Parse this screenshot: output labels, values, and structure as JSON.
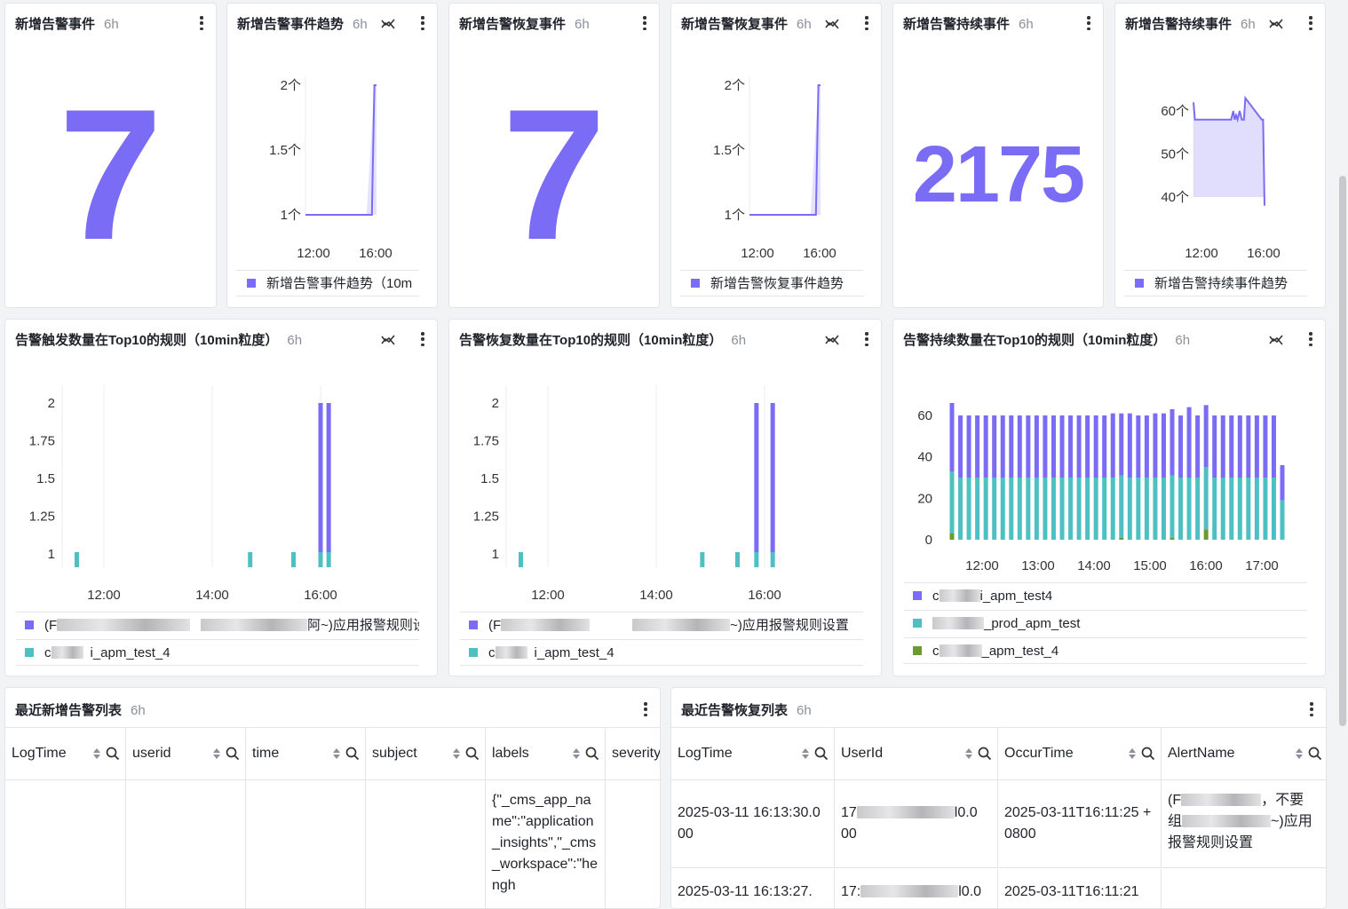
{
  "colors": {
    "purple": "#7b6cf6",
    "teal": "#4fc0c2",
    "green": "#6b9b2e",
    "area": "#d9d5fb",
    "grid": "#ececee",
    "axis": "#333333"
  },
  "icons": {
    "menu": "more-vertical-icon",
    "trend": "trend-toggle-icon",
    "sort": "sort-icon",
    "search": "search-icon"
  },
  "panels": {
    "p1": {
      "title": "新增告警事件",
      "range": "6h",
      "value": "7"
    },
    "p2": {
      "title": "新增告警事件趋势",
      "range": "6h",
      "legend": "新增告警事件趋势（10m"
    },
    "p3": {
      "title": "新增告警恢复事件",
      "range": "6h",
      "value": "7"
    },
    "p4": {
      "title": "新增告警恢复事件",
      "range": "6h",
      "legend": "新增告警恢复事件趋势"
    },
    "p5": {
      "title": "新增告警持续事件",
      "range": "6h",
      "value": "2175"
    },
    "p6": {
      "title": "新增告警持续事件",
      "range": "6h",
      "legend": "新增告警持续事件趋势"
    },
    "p7": {
      "title": "告警触发数量在Top10的规则（10min粒度）",
      "range": "6h",
      "legend": [
        {
          "prefix": "(F",
          "suffix": "阿~)应用报警规则设置"
        },
        {
          "prefix": "c",
          "suffix": "i_apm_test_4"
        }
      ]
    },
    "p8": {
      "title": "告警恢复数量在Top10的规则（10min粒度）",
      "range": "6h",
      "legend": [
        {
          "prefix": "(F",
          "suffix": "~)应用报警规则设置"
        },
        {
          "prefix": "c",
          "suffix": "i_apm_test_4"
        }
      ]
    },
    "p9": {
      "title": "告警持续数量在Top10的规则（10min粒度）",
      "range": "6h",
      "legend": [
        {
          "prefix": "c",
          "suffix": "i_apm_test4"
        },
        {
          "prefix": "",
          "suffix": "_prod_apm_test"
        },
        {
          "prefix": "c",
          "suffix": "_apm_test_4"
        }
      ]
    },
    "t1": {
      "title": "最近新增告警列表",
      "range": "6h",
      "columns": [
        "LogTime",
        "userid",
        "time",
        "subject",
        "labels",
        "severity"
      ],
      "cell_labels": "{\"_cms_app_name\":\"application_insights\",\"_cms_workspace\":\"hengh"
    },
    "t2": {
      "title": "最近告警恢复列表",
      "range": "6h",
      "columns": [
        "LogTime",
        "UserId",
        "OccurTime",
        "AlertName"
      ],
      "rows": [
        {
          "logtime": "2025-03-11 16:13:30.000",
          "userid_a": "17",
          "userid_b": "l0.0",
          "userid_c": "00",
          "occur": "2025-03-11T16:11:25 +0800",
          "alert_a": "(F",
          "alert_b": "，不要",
          "alert_c": "组",
          "alert_d": "~)应用",
          "alert_e": "报警规则设置"
        },
        {
          "logtime": "2025-03-11 16:13:27.",
          "userid_a": "17:",
          "userid_b": "l0.0",
          "occur": "2025-03-11T16:11:21"
        }
      ]
    }
  },
  "chart_data": [
    {
      "type": "line",
      "id": "p2",
      "x_ticks": [
        "12:00",
        "16:00"
      ],
      "y_ticks": [
        "1 个",
        "1.5 个",
        "2 个"
      ],
      "ylim": [
        1,
        2
      ],
      "series": [
        {
          "name": "新增告警事件趋势（10m",
          "x": [
            0,
            0.86,
            0.935,
            0.97,
            1.0
          ],
          "values": [
            1,
            1,
            1,
            2,
            2
          ]
        }
      ]
    },
    {
      "type": "line",
      "id": "p4",
      "x_ticks": [
        "12:00",
        "16:00"
      ],
      "y_ticks": [
        "1 个",
        "1.5 个",
        "2 个"
      ],
      "ylim": [
        1,
        2
      ],
      "series": [
        {
          "name": "新增告警恢复事件趋势",
          "x": [
            0,
            0.86,
            0.935,
            0.97,
            1.0
          ],
          "values": [
            1,
            1,
            1,
            2,
            2
          ]
        }
      ]
    },
    {
      "type": "area",
      "id": "p6",
      "x_ticks": [
        "12:00",
        "16:00"
      ],
      "y_ticks": [
        "40 个",
        "50 个",
        "60 个"
      ],
      "ylim": [
        40,
        60
      ],
      "series": [
        {
          "name": "新增告警持续事件趋势",
          "x": [
            0,
            0.02,
            0.5,
            0.53,
            0.56,
            0.58,
            0.6,
            0.62,
            0.65,
            0.68,
            0.71,
            0.73,
            0.96,
            0.98,
            1.0
          ],
          "values": [
            62,
            58,
            58,
            58,
            60,
            58,
            59,
            58,
            60,
            58,
            58,
            63,
            58,
            58,
            38
          ]
        }
      ]
    },
    {
      "type": "bar",
      "id": "p7",
      "x_ticks": [
        "12:00",
        "14:00",
        "16:00"
      ],
      "y_ticks": [
        "1",
        "1.25",
        "1.5",
        "1.75",
        "2"
      ],
      "ylim": [
        1,
        2
      ],
      "series": [
        {
          "name": "(F 阿~)应用报警规则设置",
          "bars": [
            {
              "x": 16.0,
              "value": 2
            },
            {
              "x": 16.15,
              "value": 2
            }
          ]
        },
        {
          "name": "c i_apm_test_4",
          "bars": [
            {
              "x": 11.5,
              "value": 1
            },
            {
              "x": 14.7,
              "value": 1
            },
            {
              "x": 15.5,
              "value": 1
            },
            {
              "x": 16.0,
              "value": 1
            },
            {
              "x": 16.15,
              "value": 1
            }
          ]
        }
      ]
    },
    {
      "type": "bar",
      "id": "p8",
      "x_ticks": [
        "12:00",
        "14:00",
        "16:00"
      ],
      "y_ticks": [
        "1",
        "1.25",
        "1.5",
        "1.75",
        "2"
      ],
      "ylim": [
        1,
        2
      ],
      "series": [
        {
          "name": "(F ~)应用报警规则设置",
          "bars": [
            {
              "x": 15.85,
              "value": 2
            },
            {
              "x": 16.15,
              "value": 2
            }
          ]
        },
        {
          "name": "c i_apm_test_4",
          "bars": [
            {
              "x": 11.5,
              "value": 1
            },
            {
              "x": 14.85,
              "value": 1
            },
            {
              "x": 15.5,
              "value": 1
            },
            {
              "x": 15.85,
              "value": 1
            },
            {
              "x": 16.15,
              "value": 1
            }
          ]
        }
      ]
    },
    {
      "type": "bar",
      "stacked": true,
      "id": "p9",
      "x_ticks": [
        "12:00",
        "13:00",
        "14:00",
        "15:00",
        "16:00",
        "17:00"
      ],
      "y_ticks": [
        "0",
        "20",
        "40",
        "60"
      ],
      "ylim": [
        0,
        70
      ],
      "series": [
        {
          "name": "c i_apm_test4",
          "values": [
            33,
            30,
            30,
            30,
            30,
            30,
            30,
            30,
            30,
            30,
            30,
            30,
            30,
            30,
            30,
            30,
            30,
            30,
            30,
            31,
            30,
            31,
            30,
            30,
            31,
            31,
            32,
            30,
            34,
            30,
            30,
            30,
            30,
            30,
            30,
            30,
            30,
            30,
            30,
            17
          ]
        },
        {
          "name": "_prod_apm_test",
          "values": [
            30,
            30,
            30,
            30,
            30,
            30,
            30,
            30,
            30,
            30,
            30,
            30,
            30,
            30,
            30,
            30,
            30,
            30,
            30,
            30,
            30,
            30,
            30,
            30,
            30,
            30,
            30,
            30,
            30,
            30,
            30,
            30,
            30,
            30,
            30,
            30,
            30,
            30,
            30,
            19
          ]
        },
        {
          "name": "c _apm_test_4",
          "values": [
            3,
            0,
            0,
            0,
            0,
            0,
            0,
            0,
            0,
            0,
            0,
            0,
            0,
            0,
            0,
            0,
            0,
            0,
            0,
            0,
            1,
            0,
            0,
            0,
            0,
            0,
            1,
            0,
            0,
            0,
            5,
            0,
            0,
            0,
            0,
            0,
            0,
            0,
            0,
            0
          ]
        }
      ]
    }
  ]
}
